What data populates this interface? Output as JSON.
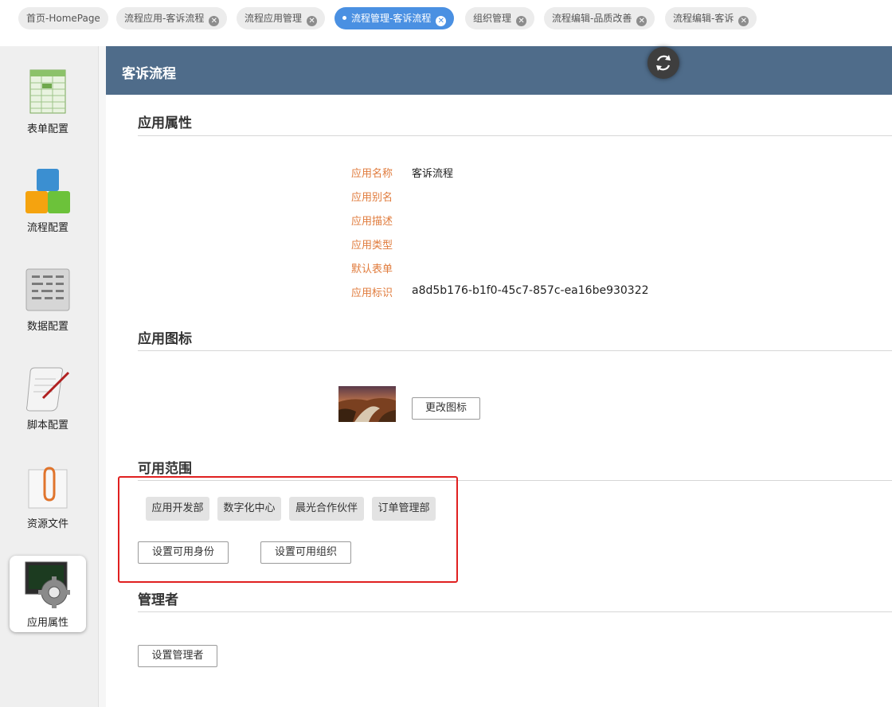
{
  "tabs": [
    {
      "label": "首页-HomePage",
      "closable": false,
      "active": false
    },
    {
      "label": "流程应用-客诉流程",
      "closable": true,
      "active": false
    },
    {
      "label": "流程应用管理",
      "closable": true,
      "active": false
    },
    {
      "label": "流程管理-客诉流程",
      "closable": true,
      "active": true
    },
    {
      "label": "组织管理",
      "closable": true,
      "active": false
    },
    {
      "label": "流程编辑-品质改善",
      "closable": true,
      "active": false
    },
    {
      "label": "流程编辑-客诉",
      "closable": true,
      "active": false
    }
  ],
  "close_glyph": "✕",
  "sidebar": {
    "items": [
      {
        "label": "表单配置",
        "icon": "spreadsheet-icon"
      },
      {
        "label": "流程配置",
        "icon": "blocks-icon"
      },
      {
        "label": "数据配置",
        "icon": "data-grid-icon"
      },
      {
        "label": "脚本配置",
        "icon": "scroll-pen-icon"
      },
      {
        "label": "资源文件",
        "icon": "paperclip-icon"
      },
      {
        "label": "应用属性",
        "icon": "settings-gear-icon",
        "active": true
      }
    ]
  },
  "header": {
    "title": "客诉流程"
  },
  "sections": {
    "properties": "应用属性",
    "icon": "应用图标",
    "scope": "可用范围",
    "managers": "管理者"
  },
  "properties": [
    {
      "label": "应用名称",
      "value": "客诉流程"
    },
    {
      "label": "应用别名",
      "value": ""
    },
    {
      "label": "应用描述",
      "value": ""
    },
    {
      "label": "应用类型",
      "value": ""
    },
    {
      "label": "默认表单",
      "value": ""
    },
    {
      "label": "应用标识",
      "value": "a8d5b176-b1f0-45c7-857c-ea16be930322"
    }
  ],
  "icon_section": {
    "change_button": "更改图标"
  },
  "scope": {
    "chips": [
      "应用开发部",
      "数字化中心",
      "晨光合作伙伴",
      "订单管理部"
    ],
    "set_identity_button": "设置可用身份",
    "set_org_button": "设置可用组织"
  },
  "managers": {
    "set_manager_button": "设置管理者"
  },
  "colors": {
    "header_bg": "#4f6c8a",
    "label": "#e07b3c",
    "active_tab": "#4a90e2",
    "highlight_box": "#e02020"
  }
}
